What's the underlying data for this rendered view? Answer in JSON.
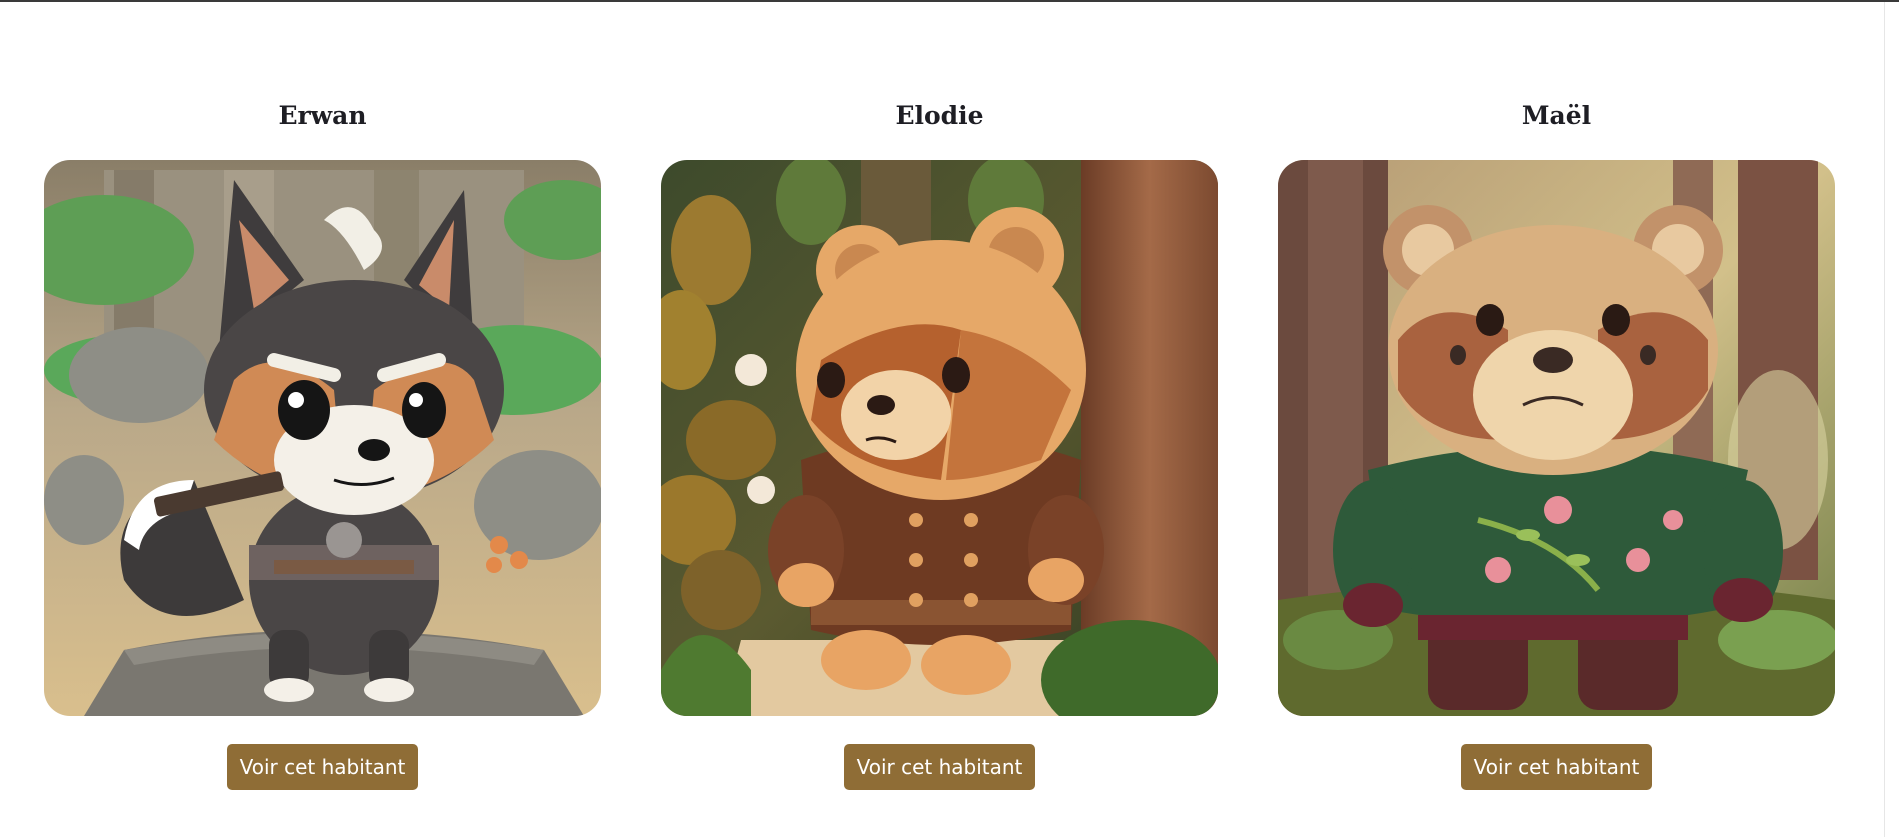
{
  "colors": {
    "button_bg": "#8f6d36",
    "button_text": "#ffffff",
    "title_text": "#1e1e24",
    "top_rule": "#3a3a3a"
  },
  "habitants": [
    {
      "name": "Erwan",
      "image_icon": "wolf-character-portrait",
      "button_label": "Voir cet habitant"
    },
    {
      "name": "Elodie",
      "image_icon": "bear-in-coat-portrait",
      "button_label": "Voir cet habitant"
    },
    {
      "name": "Maël",
      "image_icon": "bear-in-sweater-portrait",
      "button_label": "Voir cet habitant"
    }
  ]
}
